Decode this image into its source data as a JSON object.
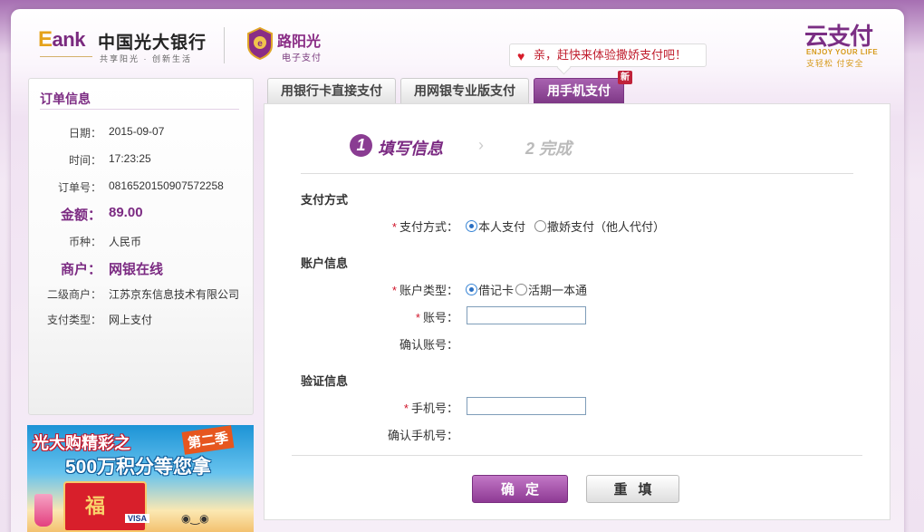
{
  "header": {
    "eank_logo_e": "E",
    "eank_logo_rest": "ank",
    "bank_name": "中国光大银行",
    "bank_slogan": "共享阳光 · 创新生活",
    "partner_name": "路阳光",
    "partner_sub": "电子支付",
    "promo_text": "亲，赶快来体验撒娇支付吧！",
    "yun_logo": "云支付",
    "yun_sub_en": "ENJOY YOUR LIFE",
    "yun_sub_cn": "支轻松  付安全"
  },
  "order": {
    "title": "订单信息",
    "rows": [
      {
        "label": "日期：",
        "value": "2015-09-07"
      },
      {
        "label": "时间：",
        "value": "17:23:25"
      },
      {
        "label": "订单号：",
        "value": "0816520150907572258"
      },
      {
        "label": "金额：",
        "value": "89.00"
      },
      {
        "label": "币种：",
        "value": "人民币"
      },
      {
        "label": "商户：",
        "value": "网银在线"
      },
      {
        "label": "二级商户：",
        "value": "江苏京东信息技术有限公司"
      },
      {
        "label": "支付类型：",
        "value": "网上支付"
      }
    ]
  },
  "banner": {
    "line1": "光大购精彩之",
    "season": "第二季",
    "line2": "500万积分等您拿",
    "card_char": "福",
    "visa": "VISA"
  },
  "tabs": [
    {
      "label": "用银行卡直接支付",
      "active": false
    },
    {
      "label": "用网银专业版支付",
      "active": false
    },
    {
      "label": "用手机支付",
      "active": true
    }
  ],
  "new_badge": "新",
  "steps": {
    "step1_num": "1",
    "step1_label": "填写信息",
    "arrow": "›",
    "step2_label": "2 完成"
  },
  "form": {
    "section_payment": "支付方式",
    "payment_method_label": "支付方式：",
    "payment_options": [
      "本人支付",
      "撒娇支付（他人代付）"
    ],
    "payment_selected": "本人支付",
    "section_account": "账户信息",
    "account_type_label": "账户类型：",
    "account_type_options": [
      "借记卡",
      "活期一本通"
    ],
    "account_type_selected": "借记卡",
    "account_no_label": "账号：",
    "account_no_value": "",
    "confirm_account_label": "确认账号：",
    "section_verify": "验证信息",
    "phone_label": "手机号：",
    "phone_value": "",
    "confirm_phone_label": "确认手机号："
  },
  "buttons": {
    "confirm": "确定",
    "reset": "重填"
  },
  "colors": {
    "brand_purple": "#7b2a82",
    "required_red": "#d0152a"
  }
}
